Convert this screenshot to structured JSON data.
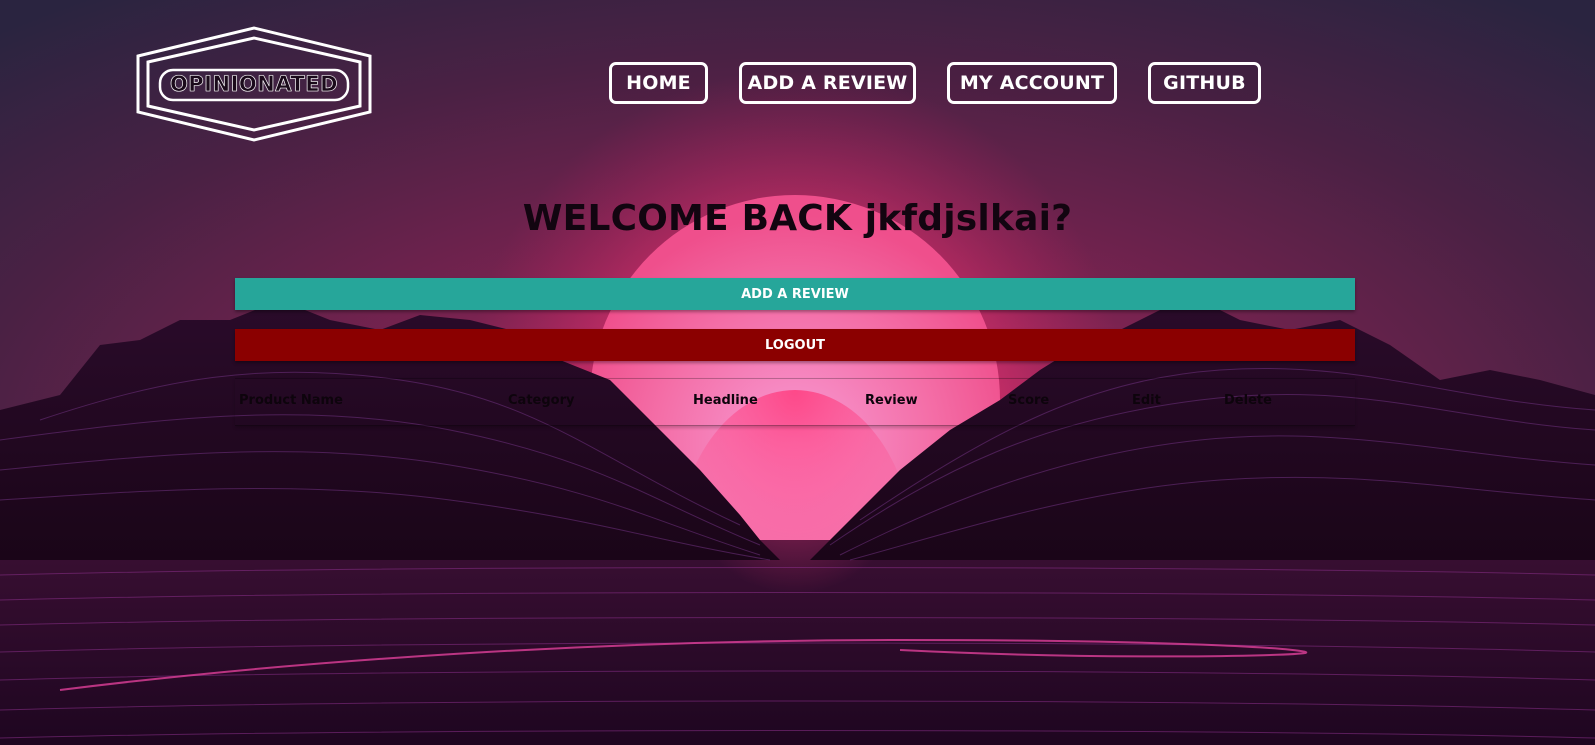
{
  "brand": {
    "logo_text": "OPINIONATED"
  },
  "nav": {
    "items": [
      {
        "label": "HOME"
      },
      {
        "label": "ADD A REVIEW"
      },
      {
        "label": "MY ACCOUNT"
      },
      {
        "label": "GITHUB"
      }
    ]
  },
  "main": {
    "welcome_text": "WELCOME BACK jkfdjslkai?",
    "add_review_label": "ADD A REVIEW",
    "logout_label": "LOGOUT",
    "table": {
      "columns": [
        "Product Name",
        "Category",
        "Headline",
        "Review",
        "Score",
        "Edit",
        "Delete"
      ],
      "rows": []
    }
  },
  "colors": {
    "add_review_button": "#26a69a",
    "logout_button": "#8b0000",
    "nav_border": "#ffffff"
  },
  "icons": {
    "logo": "hexagon-badge-icon"
  }
}
